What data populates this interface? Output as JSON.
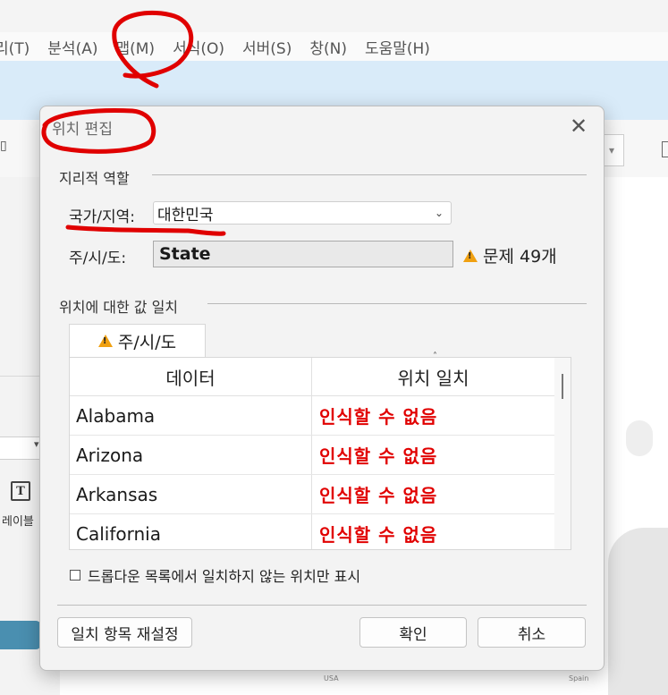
{
  "menubar": {
    "items": [
      "리(T)",
      "분석(A)",
      "맵(M)",
      "서식(O)",
      "서버(S)",
      "창(N)",
      "도움말(H)"
    ]
  },
  "left_panel": {
    "text_icon": "T",
    "label": "레이블"
  },
  "map": {
    "labels": [
      "USA",
      "Spain"
    ]
  },
  "dialog": {
    "title": "위치 편집",
    "close": "✕",
    "geo_role": {
      "section_title": "지리적 역할",
      "country_label": "국가/지역:",
      "country_value": "대한민국",
      "state_label": "주/시/도:",
      "state_value": "State",
      "issues": "문제 49개"
    },
    "match": {
      "section_title": "위치에 대한 값 일치",
      "tab_label": "주/시/도",
      "columns": [
        "데이터",
        "위치 일치"
      ],
      "rows": [
        {
          "data": "Alabama",
          "match": "인식할 수 없음"
        },
        {
          "data": "Arizona",
          "match": "인식할 수 없음"
        },
        {
          "data": "Arkansas",
          "match": "인식할 수 없음"
        },
        {
          "data": "California",
          "match": "인식할 수 없음"
        }
      ],
      "checkbox_label": "드롭다운 목록에서 일치하지 않는 위치만 표시"
    },
    "buttons": {
      "reset": "일치 항목 재설정",
      "ok": "확인",
      "cancel": "취소"
    }
  },
  "colors": {
    "unrecognized_text": "#e10000",
    "warning": "#f0a010",
    "annotation": "#e00000",
    "ribbon": "#d9ebf9"
  }
}
